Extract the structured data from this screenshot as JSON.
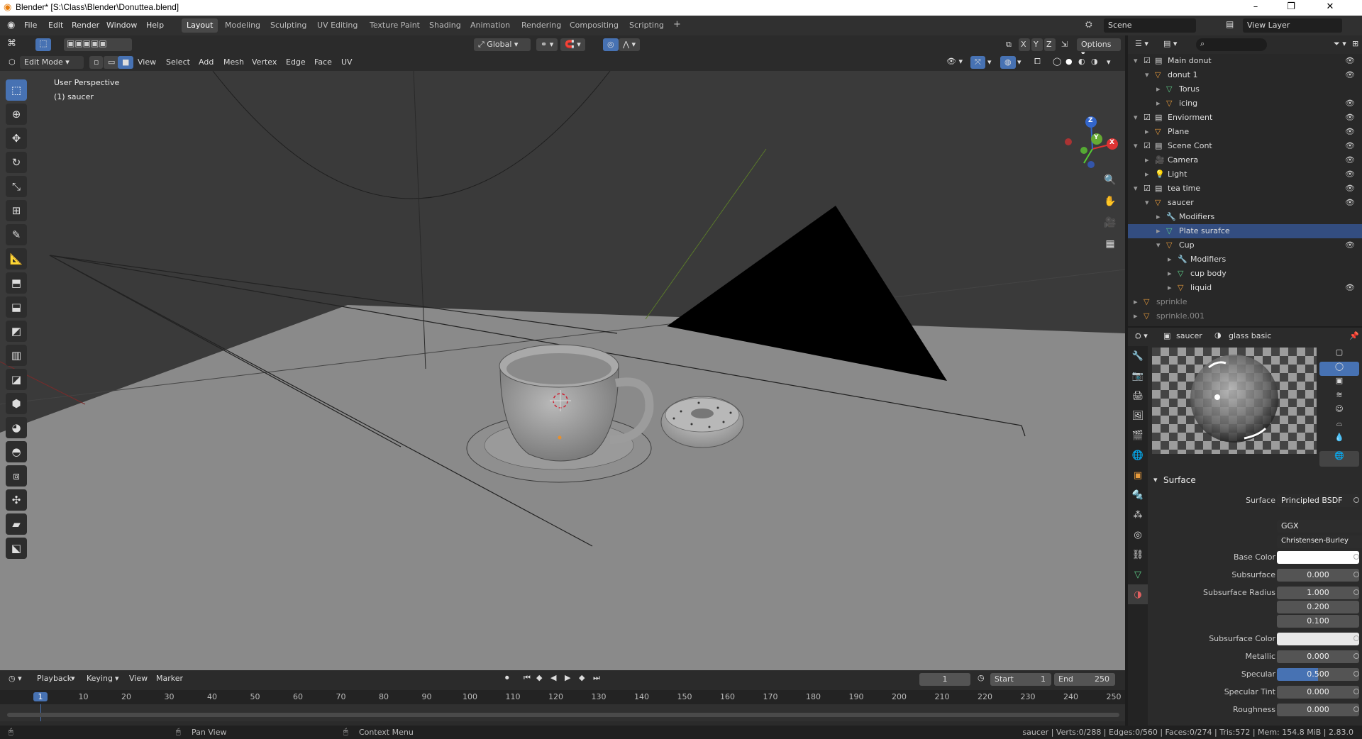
{
  "window": {
    "title": "Blender* [S:\\Class\\Blender\\Donuttea.blend]",
    "controls": [
      "–",
      "❐",
      "✕"
    ]
  },
  "menu": [
    "File",
    "Edit",
    "Render",
    "Window",
    "Help"
  ],
  "workspaces": [
    "Layout",
    "Modeling",
    "Sculpting",
    "UV Editing",
    "Texture Paint",
    "Shading",
    "Animation",
    "Rendering",
    "Compositing",
    "Scripting",
    "+"
  ],
  "scene": {
    "name": "Scene",
    "view_layer": "View Layer"
  },
  "viewport": {
    "transform": "Global",
    "options": "Options",
    "axes": [
      "X",
      "Y",
      "Z"
    ],
    "mode": "Edit Mode",
    "menus": [
      "View",
      "Select",
      "Add",
      "Mesh",
      "Vertex",
      "Edge",
      "Face",
      "UV"
    ],
    "overlay_line1": "User Perspective",
    "overlay_line2": "(1) saucer",
    "gizmo": {
      "x": "X",
      "y": "Y",
      "z": "Z"
    }
  },
  "outliner": {
    "rows": [
      {
        "label": "Main donut",
        "indent": 0,
        "type": "collection",
        "eye": true
      },
      {
        "label": "donut 1",
        "indent": 1,
        "type": "object",
        "eye": true
      },
      {
        "label": "Torus",
        "indent": 2,
        "type": "mesh",
        "eye": false
      },
      {
        "label": "icing",
        "indent": 2,
        "type": "object",
        "eye": true
      },
      {
        "label": "Enviorment",
        "indent": 0,
        "type": "collection",
        "eye": true
      },
      {
        "label": "Plane",
        "indent": 1,
        "type": "object",
        "eye": true
      },
      {
        "label": "Scene Cont",
        "indent": 0,
        "type": "collection",
        "eye": true
      },
      {
        "label": "Camera",
        "indent": 1,
        "type": "camera",
        "eye": true
      },
      {
        "label": "Light",
        "indent": 1,
        "type": "light",
        "eye": true
      },
      {
        "label": "tea time",
        "indent": 0,
        "type": "collection",
        "eye": true
      },
      {
        "label": "saucer",
        "indent": 1,
        "type": "object",
        "eye": true
      },
      {
        "label": "Modifiers",
        "indent": 2,
        "type": "modifier",
        "eye": false
      },
      {
        "label": "Plate surafce",
        "indent": 2,
        "type": "mesh",
        "eye": false,
        "selected": true
      },
      {
        "label": "Cup",
        "indent": 2,
        "type": "object",
        "eye": true
      },
      {
        "label": "Modifiers",
        "indent": 3,
        "type": "modifier",
        "eye": false
      },
      {
        "label": "cup body",
        "indent": 3,
        "type": "mesh",
        "eye": false
      },
      {
        "label": "liquid",
        "indent": 3,
        "type": "object",
        "eye": true
      },
      {
        "label": "sprinkle",
        "indent": -1,
        "type": "object",
        "eye": false,
        "dim": true
      },
      {
        "label": "sprinkle.001",
        "indent": -1,
        "type": "object",
        "eye": false,
        "dim": true
      }
    ]
  },
  "properties": {
    "object": "saucer",
    "material": "glass basic",
    "section": "Surface",
    "surface_label": "Surface",
    "surface_value": "Principled BSDF",
    "distribution": "GGX",
    "subsurface_method": "Christensen-Burley",
    "fields": [
      {
        "label": "Base Color",
        "value": "",
        "kind": "color",
        "color": "#ffffff"
      },
      {
        "label": "Subsurface",
        "value": "0.000"
      },
      {
        "label": "Subsurface Radius",
        "value": "1.000"
      },
      {
        "label": "",
        "value": "0.200"
      },
      {
        "label": "",
        "value": "0.100"
      },
      {
        "label": "Subsurface Color",
        "value": "",
        "kind": "color",
        "color": "#e8e8e8"
      },
      {
        "label": "Metallic",
        "value": "0.000"
      },
      {
        "label": "Specular",
        "value": "0.500",
        "fill": 0.5
      },
      {
        "label": "Specular Tint",
        "value": "0.000"
      },
      {
        "label": "Roughness",
        "value": "0.000"
      }
    ]
  },
  "timeline": {
    "menus": [
      "Playback",
      "Keying",
      "View",
      "Marker"
    ],
    "current_frame": "1",
    "start_label": "Start",
    "start": "1",
    "end_label": "End",
    "end": "250",
    "ruler": [
      "1",
      "10",
      "20",
      "30",
      "40",
      "50",
      "60",
      "70",
      "80",
      "90",
      "100",
      "110",
      "120",
      "130",
      "140",
      "150",
      "160",
      "170",
      "180",
      "190",
      "200",
      "210",
      "220",
      "230",
      "240",
      "250"
    ]
  },
  "status": {
    "pan": "Pan View",
    "context": "Context Menu",
    "stats": "saucer | Verts:0/288 | Edges:0/560 | Faces:0/274 | Tris:572 | Mem: 154.8 MiB | 2.83.0"
  },
  "colors": {
    "accent": "#4772b3",
    "selected_row": "#334d80",
    "object_orange": "#e89b3c",
    "mesh_green": "#5fcf8a"
  }
}
